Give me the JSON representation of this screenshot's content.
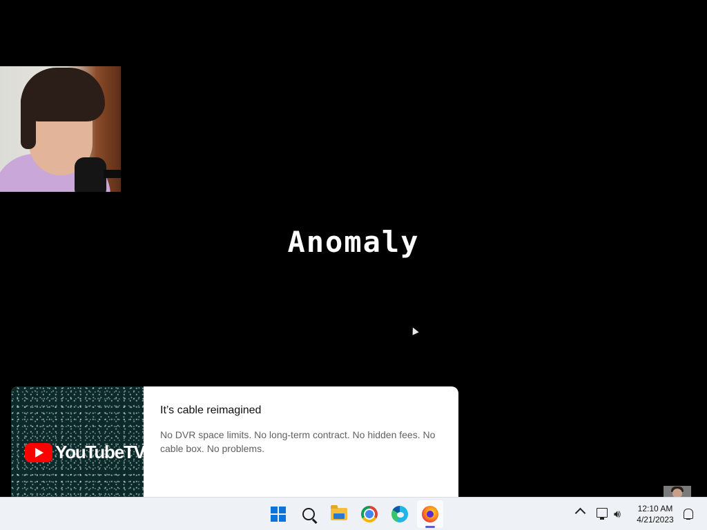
{
  "game": {
    "title": "Anomaly"
  },
  "ad": {
    "brand": "YouTubeTV",
    "title": "It’s cable reimagined",
    "description": "No DVR space limits. No long-term contract. No hidden fees. No cable box. No problems."
  },
  "taskbar": {
    "apps": [
      {
        "name": "start",
        "icon": "windows-logo-icon"
      },
      {
        "name": "search",
        "icon": "search-icon"
      },
      {
        "name": "file-explorer",
        "icon": "folder-icon"
      },
      {
        "name": "chrome",
        "icon": "chrome-icon"
      },
      {
        "name": "edge",
        "icon": "edge-icon"
      },
      {
        "name": "firefox",
        "icon": "firefox-icon",
        "active": true
      }
    ],
    "clock": {
      "time": "12:10 AM",
      "date": "4/21/2023"
    },
    "tray_volume_glyph": "🔊︎"
  },
  "colors": {
    "youtube_red": "#ff0000",
    "windows_blue": "#0a74da",
    "taskbar_bg": "#eef1f5",
    "active_indicator": "#5b5fc7"
  }
}
